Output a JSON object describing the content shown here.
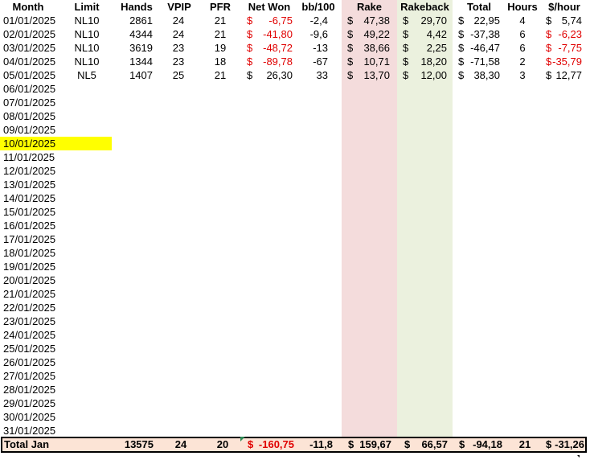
{
  "headers": {
    "month": "Month",
    "limit": "Limit",
    "hands": "Hands",
    "vpip": "VPIP",
    "pfr": "PFR",
    "net_won": "Net Won",
    "bb100": "bb/100",
    "rake": "Rake",
    "rakeback": "Rakeback",
    "total": "Total",
    "hours": "Hours",
    "per_hour": "$/hour"
  },
  "currency": "$",
  "selected_cell": "10/01/2025",
  "colors": {
    "rake_column": "#f4dcdc",
    "rakeback_column": "#ebf1de",
    "selection": "#ffff00",
    "negative": "#e00000",
    "total_row": "#fce4d6"
  },
  "rows": [
    {
      "date": "01/01/2025",
      "limit": "NL10",
      "hands": "2861",
      "vpip": "24",
      "pfr": "21",
      "net": "-6,75",
      "bb": "-2,4",
      "rake": "47,38",
      "rb": "29,70",
      "total": "22,95",
      "hours": "4",
      "ph": "5,74"
    },
    {
      "date": "02/01/2025",
      "limit": "NL10",
      "hands": "4344",
      "vpip": "24",
      "pfr": "21",
      "net": "-41,80",
      "bb": "-9,6",
      "rake": "49,22",
      "rb": "4,42",
      "total": "-37,38",
      "hours": "6",
      "ph": "-6,23"
    },
    {
      "date": "03/01/2025",
      "limit": "NL10",
      "hands": "3619",
      "vpip": "23",
      "pfr": "19",
      "net": "-48,72",
      "bb": "-13",
      "rake": "38,66",
      "rb": "2,25",
      "total": "-46,47",
      "hours": "6",
      "ph": "-7,75"
    },
    {
      "date": "04/01/2025",
      "limit": "NL10",
      "hands": "1344",
      "vpip": "23",
      "pfr": "18",
      "net": "-89,78",
      "bb": "-67",
      "rake": "10,71",
      "rb": "18,20",
      "total": "-71,58",
      "hours": "2",
      "ph": "-35,79"
    },
    {
      "date": "05/01/2025",
      "limit": "NL5",
      "hands": "1407",
      "vpip": "25",
      "pfr": "21",
      "net": "26,30",
      "bb": "33",
      "rake": "13,70",
      "rb": "12,00",
      "total": "38,30",
      "hours": "3",
      "ph": "12,77"
    },
    {
      "date": "06/01/2025"
    },
    {
      "date": "07/01/2025"
    },
    {
      "date": "08/01/2025"
    },
    {
      "date": "09/01/2025"
    },
    {
      "date": "10/01/2025"
    },
    {
      "date": "11/01/2025"
    },
    {
      "date": "12/01/2025"
    },
    {
      "date": "13/01/2025"
    },
    {
      "date": "14/01/2025"
    },
    {
      "date": "15/01/2025"
    },
    {
      "date": "16/01/2025"
    },
    {
      "date": "17/01/2025"
    },
    {
      "date": "18/01/2025"
    },
    {
      "date": "19/01/2025"
    },
    {
      "date": "20/01/2025"
    },
    {
      "date": "21/01/2025"
    },
    {
      "date": "22/01/2025"
    },
    {
      "date": "23/01/2025"
    },
    {
      "date": "24/01/2025"
    },
    {
      "date": "25/01/2025"
    },
    {
      "date": "26/01/2025"
    },
    {
      "date": "27/01/2025"
    },
    {
      "date": "28/01/2025"
    },
    {
      "date": "29/01/2025"
    },
    {
      "date": "30/01/2025"
    },
    {
      "date": "31/01/2025"
    }
  ],
  "total": {
    "label": "Total Jan",
    "hands": "13575",
    "vpip": "24",
    "pfr": "20",
    "net": "-160,75",
    "bb": "-11,8",
    "rake": "159,67",
    "rb": "66,57",
    "total": "-94,18",
    "hours": "21",
    "ph": "-31,26"
  }
}
